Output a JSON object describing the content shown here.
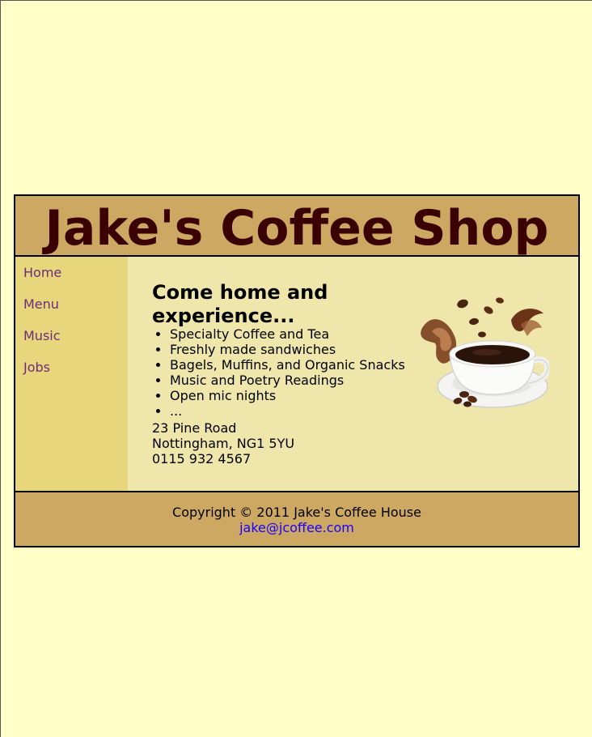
{
  "header": {
    "title": "Jake's Coffee Shop"
  },
  "nav": {
    "items": [
      {
        "label": "Home"
      },
      {
        "label": "Menu"
      },
      {
        "label": "Music"
      },
      {
        "label": "Jobs"
      }
    ]
  },
  "main": {
    "heading": "Come home and experience...",
    "features": [
      "Specialty Coffee and Tea",
      "Freshly made sandwiches",
      "Bagels, Muffins, and Organic Snacks",
      "Music and Poetry Readings",
      "Open mic nights",
      "..."
    ],
    "address": {
      "street": "23 Pine Road",
      "city": "Nottingham, NG1 5YU",
      "phone": "0115 932 4567"
    }
  },
  "footer": {
    "copyright": "Copyright © 2011 Jake's Coffee House",
    "email": "jake@jcoffee.com"
  },
  "colors": {
    "page_bg": "#ffffc8",
    "header_bg": "#cca862",
    "nav_bg": "#e8d67c",
    "content_bg": "#efe6ac",
    "title": "#3b0000",
    "link": "#6b2d7a"
  }
}
